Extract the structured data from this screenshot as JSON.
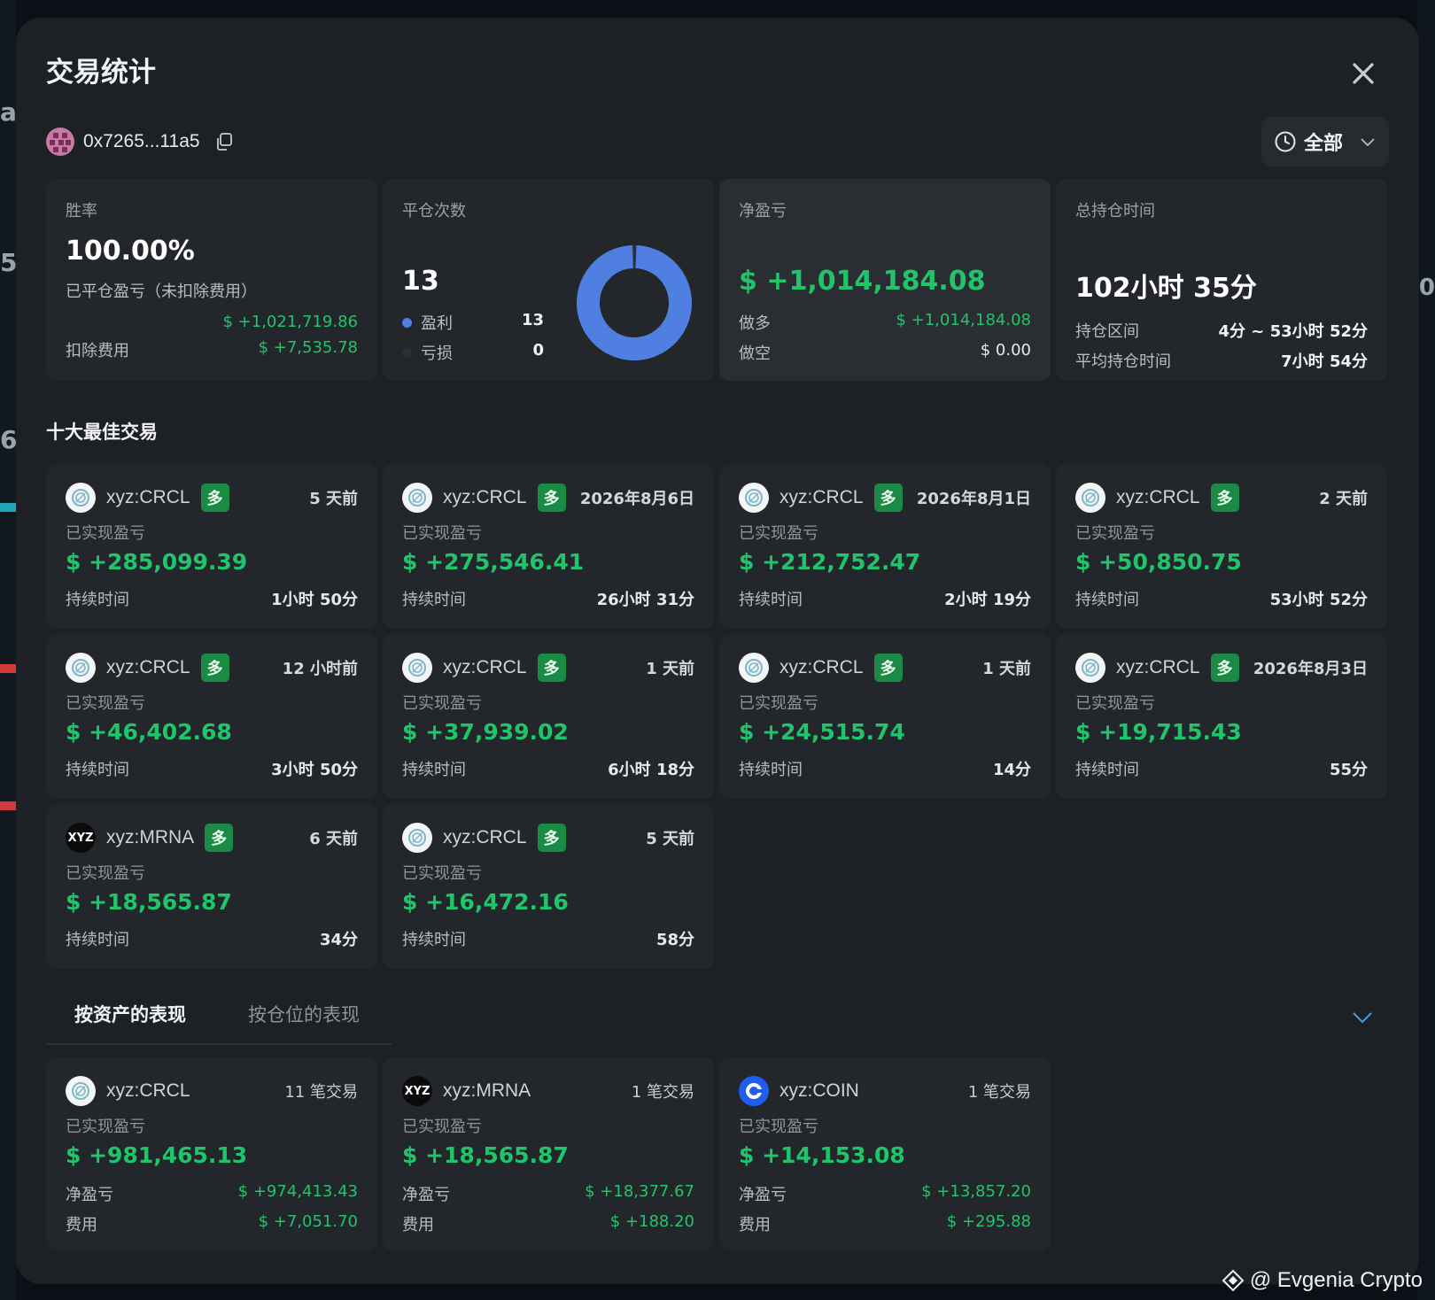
{
  "modal": {
    "title": "交易统计",
    "address": "0x7265...11a5",
    "filter_label": "全部"
  },
  "stats": {
    "win_rate": {
      "label": "胜率",
      "value": "100.00%",
      "closed_pnl_label": "已平仓盈亏（未扣除费用）",
      "closed_pnl_value": "$ +1,021,719.86",
      "fee_label": "扣除费用",
      "fee_value": "$ +7,535.78"
    },
    "closes": {
      "label": "平仓次数",
      "value": "13",
      "profit_label": "盈利",
      "profit_value": "13",
      "loss_label": "亏损",
      "loss_value": "0",
      "profit_count": 13,
      "loss_count": 0,
      "profit_color": "#4f7fe0",
      "loss_color": "#2b3038"
    },
    "net_pnl": {
      "label": "净盈亏",
      "value": "$ +1,014,184.08",
      "long_label": "做多",
      "long_value": "$ +1,014,184.08",
      "short_label": "做空",
      "short_value": "$ 0.00"
    },
    "hold_time": {
      "label": "总持仓时间",
      "value": "102小时 35分",
      "range_label": "持仓区间",
      "range_value": "4分 ~ 53小时 52分",
      "avg_label": "平均持仓时间",
      "avg_value": "7小时 54分"
    }
  },
  "top_trades": {
    "title": "十大最佳交易",
    "pnl_label": "已实现盈亏",
    "duration_label": "持续时间",
    "side_label": "多",
    "items": [
      {
        "symbol": "xyz:CRCL",
        "icon": "crcl-icon",
        "time": "5 天前",
        "pnl": "$ +285,099.39",
        "duration": "1小时 50分"
      },
      {
        "symbol": "xyz:CRCL",
        "icon": "crcl-icon",
        "time": "2026年8月6日",
        "pnl": "$ +275,546.41",
        "duration": "26小时 31分"
      },
      {
        "symbol": "xyz:CRCL",
        "icon": "crcl-icon",
        "time": "2026年8月1日",
        "pnl": "$ +212,752.47",
        "duration": "2小时 19分"
      },
      {
        "symbol": "xyz:CRCL",
        "icon": "crcl-icon",
        "time": "2 天前",
        "pnl": "$ +50,850.75",
        "duration": "53小时 52分"
      },
      {
        "symbol": "xyz:CRCL",
        "icon": "crcl-icon",
        "time": "12 小时前",
        "pnl": "$ +46,402.68",
        "duration": "3小时 50分"
      },
      {
        "symbol": "xyz:CRCL",
        "icon": "crcl-icon",
        "time": "1 天前",
        "pnl": "$ +37,939.02",
        "duration": "6小时 18分"
      },
      {
        "symbol": "xyz:CRCL",
        "icon": "crcl-icon",
        "time": "1 天前",
        "pnl": "$ +24,515.74",
        "duration": "14分"
      },
      {
        "symbol": "xyz:CRCL",
        "icon": "crcl-icon",
        "time": "2026年8月3日",
        "pnl": "$ +19,715.43",
        "duration": "55分"
      },
      {
        "symbol": "xyz:MRNA",
        "icon": "xyz-icon",
        "time": "6 天前",
        "pnl": "$ +18,565.87",
        "duration": "34分"
      },
      {
        "symbol": "xyz:CRCL",
        "icon": "crcl-icon",
        "time": "5 天前",
        "pnl": "$ +16,472.16",
        "duration": "58分"
      }
    ]
  },
  "performance": {
    "tab_assets": "按资产的表现",
    "tab_positions": "按仓位的表现",
    "pnl_label": "已实现盈亏",
    "net_label": "净盈亏",
    "fee_label": "费用",
    "items": [
      {
        "symbol": "xyz:CRCL",
        "icon": "crcl-icon",
        "count": "11 笔交易",
        "pnl": "$ +981,465.13",
        "net": "$ +974,413.43",
        "fee": "$ +7,051.70"
      },
      {
        "symbol": "xyz:MRNA",
        "icon": "xyz-icon",
        "count": "1 笔交易",
        "pnl": "$ +18,565.87",
        "net": "$ +18,377.67",
        "fee": "$ +188.20"
      },
      {
        "symbol": "xyz:COIN",
        "icon": "coinbase-icon",
        "count": "1 笔交易",
        "pnl": "$ +14,153.08",
        "net": "$ +13,857.20",
        "fee": "$ +295.88"
      }
    ]
  },
  "icons": {
    "xyz_text": "XYZ"
  },
  "watermark": "@ Evgenia Crypto",
  "colors": {
    "profit": "#21c46b",
    "long_tag": "#1a8a44",
    "modal_bg": "#1d2024",
    "card_bg": "#23272b"
  }
}
